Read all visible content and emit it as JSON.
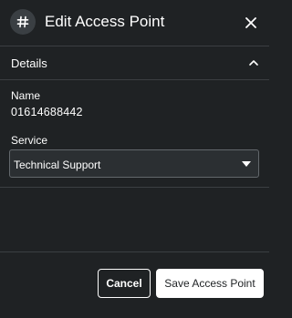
{
  "dialog": {
    "title": "Edit Access Point",
    "header_icon": "hash-icon",
    "close_icon": "close-icon"
  },
  "details": {
    "section_title": "Details",
    "collapse_icon": "chevron-up-icon",
    "name_label": "Name",
    "name_value": "01614688442",
    "service_label": "Service",
    "service_selected": "Technical Support",
    "service_caret_icon": "caret-down-icon"
  },
  "footer": {
    "cancel_label": "Cancel",
    "save_label": "Save Access Point"
  },
  "colors": {
    "background": "#1f2224",
    "icon_circle": "#3a3f43",
    "divider": "#3b3f42",
    "select_background": "#2b2f32",
    "select_border": "#63686c",
    "text": "#ffffff"
  }
}
